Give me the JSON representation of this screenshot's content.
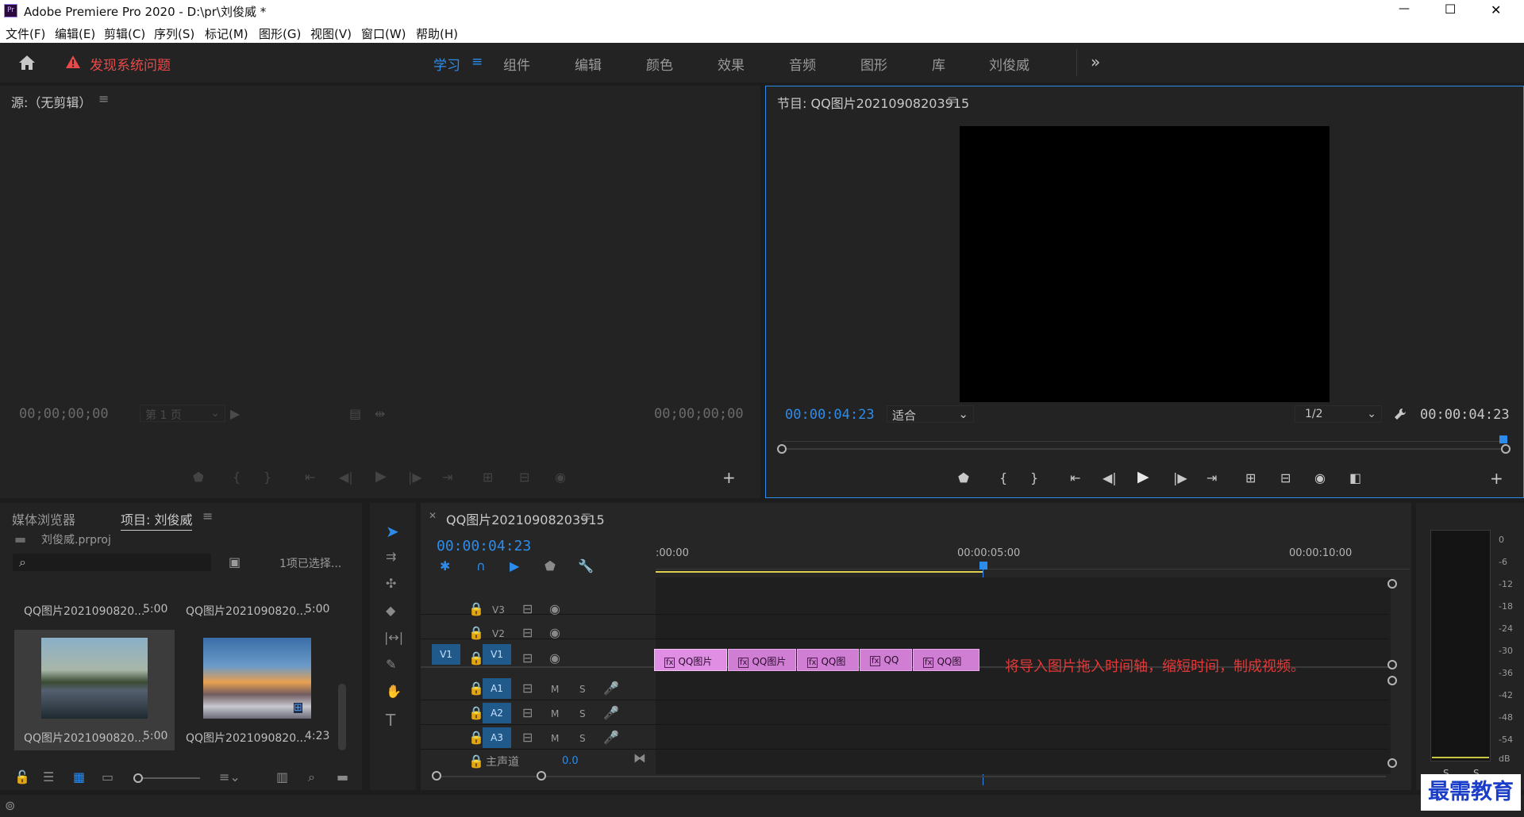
{
  "app": {
    "title": "Adobe Premiere Pro 2020 - D:\\pr\\刘俊威 *",
    "logo": "Pr"
  },
  "window_controls": {
    "minimize": "—",
    "maximize": "☐",
    "close": "✕"
  },
  "menu": [
    "文件(F)",
    "编辑(E)",
    "剪辑(C)",
    "序列(S)",
    "标记(M)",
    "图形(G)",
    "视图(V)",
    "窗口(W)",
    "帮助(H)"
  ],
  "workspace": {
    "alert": "发现系统问题",
    "tabs": [
      "学习",
      "组件",
      "编辑",
      "颜色",
      "效果",
      "音频",
      "图形",
      "库",
      "刘俊威"
    ],
    "active": "学习",
    "more": "»"
  },
  "source": {
    "title": "源:（无剪辑）",
    "tc_left": "00;00;00;00",
    "tc_right": "00;00;00;00",
    "page": "第 1 页"
  },
  "program": {
    "title": "节目: QQ图片20210908203915",
    "tc_left": "00:00:04:23",
    "tc_right": "00:00:04:23",
    "fit": "适合",
    "resolution": "1/2"
  },
  "project": {
    "tab_media": "媒体浏览器",
    "tab_project": "项目: 刘俊威",
    "file": "刘俊威.prproj",
    "selected": "1项已选择...",
    "items": [
      {
        "name": "QQ图片2021090820...",
        "dur": "5:00"
      },
      {
        "name": "QQ图片2021090820...",
        "dur": "5:00"
      },
      {
        "name": "QQ图片2021090820...",
        "dur": "5:00"
      },
      {
        "name": "QQ图片2021090820...",
        "dur": "4:23"
      }
    ]
  },
  "timeline": {
    "title": "QQ图片20210908203915",
    "tc": "00:00:04:23",
    "ruler": [
      ":00:00",
      "00:00:05:00",
      "00:00:10:00"
    ],
    "tracks_video": [
      "V3",
      "V2",
      "V1"
    ],
    "tracks_audio": [
      "A1",
      "A2",
      "A3"
    ],
    "src_v1": "V1",
    "master": "主声道",
    "master_val": "0.0",
    "m": "M",
    "s": "S",
    "clips": [
      "QQ图片",
      "QQ图片",
      "QQ图",
      "QQ",
      "QQ图"
    ],
    "annotation": "将导入图片拖入时间轴，缩短时间，制成视频。"
  },
  "meter": {
    "labels": [
      "0",
      "-6",
      "-12",
      "-18",
      "-24",
      "-30",
      "-36",
      "-42",
      "-48",
      "-54",
      "dB"
    ],
    "solo": [
      "S",
      "S"
    ]
  },
  "watermark": "最需教育",
  "colors": {
    "accent": "#2d8ceb",
    "clip": "#d07ed4",
    "alert": "#e84a4a",
    "annotation": "#e03a3a"
  }
}
